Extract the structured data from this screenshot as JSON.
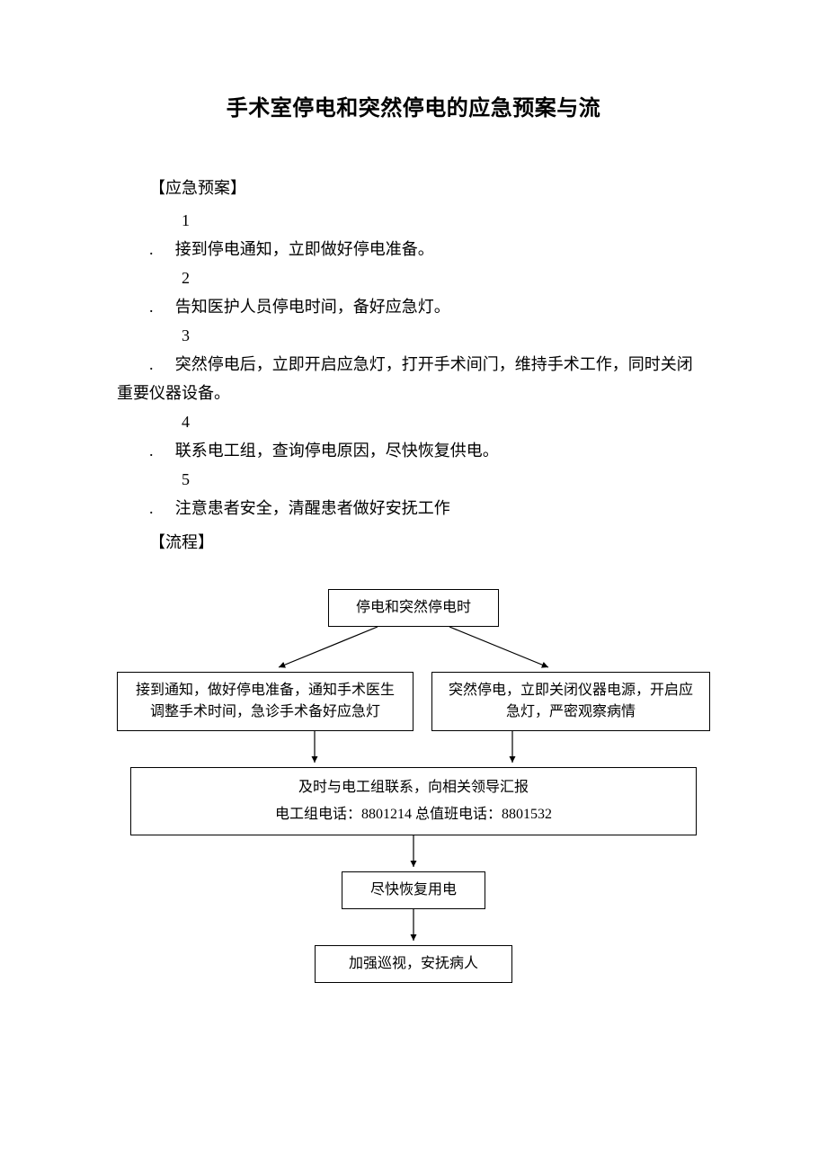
{
  "title": "手术室停电和突然停电的应急预案与流",
  "section_plan": "【应急预案】",
  "plan": [
    "接到停电通知，立即做好停电准备。",
    "告知医护人员停电时间，备好应急灯。",
    "突然停电后，立即开启应急灯，打开手术间门，维持手术工作，同时关闭重要仪器设备。",
    "联系电工组，查询停电原因，尽快恢复供电。",
    "注意患者安全，清醒患者做好安抚工作"
  ],
  "plan_nums": [
    "1 .",
    "2  .",
    "3  .",
    "4  .",
    "5  ."
  ],
  "section_flow": "【流程】",
  "flow": {
    "top": "停电和突然停电时",
    "left": "接到通知，做好停电准备，通知手术医生调整手术时间，急诊手术备好应急灯",
    "right": "突然停电，立即关闭仪器电源，开启应急灯，严密观察病情",
    "contact_l1": "及时与电工组联系，向相关领导汇报",
    "contact_l2_pre": "电工组电话：",
    "contact_l2_n1": "8801214",
    "contact_l2_mid": " 总值班电话：",
    "contact_l2_n2": "8801532",
    "restore": "尽快恢复用电",
    "final": "加强巡视，安抚病人"
  }
}
